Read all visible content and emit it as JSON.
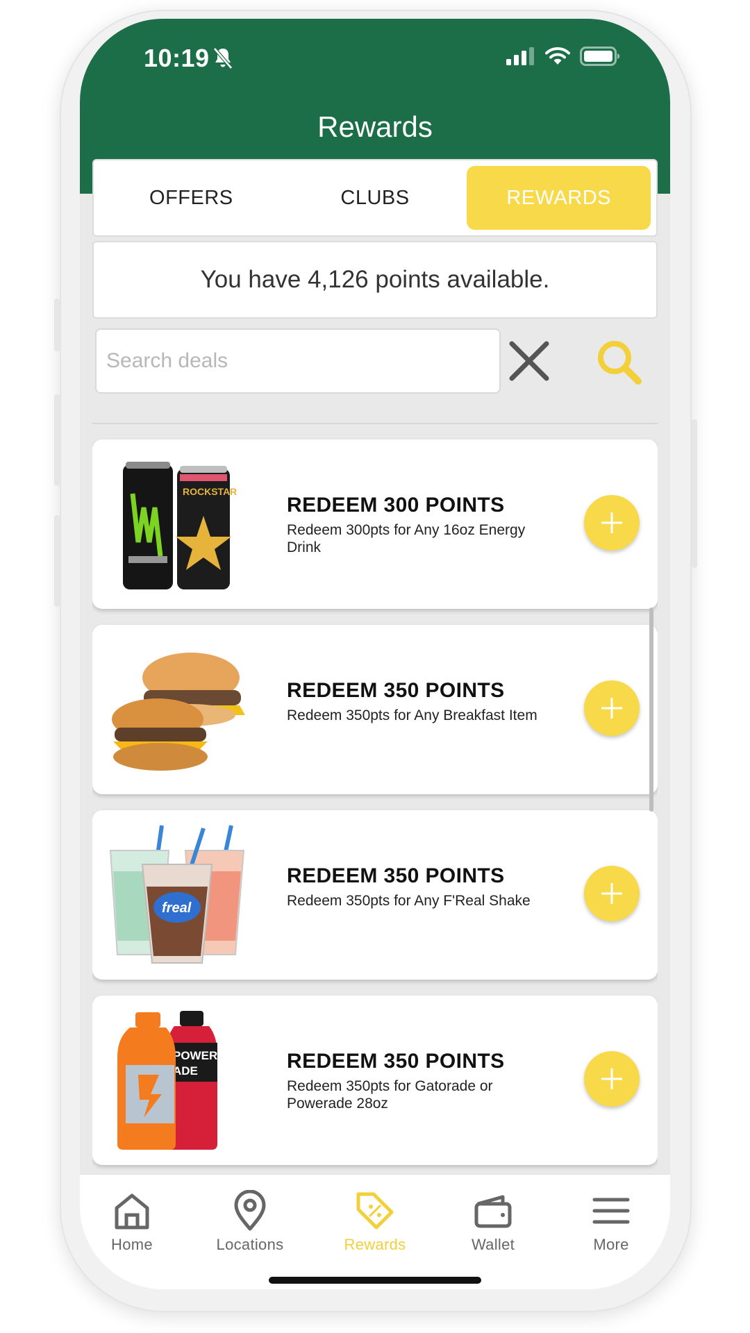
{
  "status_bar": {
    "time": "10:19"
  },
  "header": {
    "title": "Rewards"
  },
  "tabs": [
    {
      "label": "OFFERS",
      "active": false
    },
    {
      "label": "CLUBS",
      "active": false
    },
    {
      "label": "REWARDS",
      "active": true
    }
  ],
  "points": {
    "text": "You have 4,126 points available."
  },
  "search": {
    "placeholder": "Search deals",
    "value": ""
  },
  "rewards": [
    {
      "title": "REDEEM 300 POINTS",
      "description": "Redeem 300pts for Any 16oz Energy Drink",
      "image": "energy-drink-cans"
    },
    {
      "title": "REDEEM 350 POINTS",
      "description": "Redeem 350pts for Any Breakfast Item",
      "image": "breakfast-sandwiches"
    },
    {
      "title": "REDEEM 350 POINTS",
      "description": "Redeem 350pts for Any F'Real Shake",
      "image": "freal-shakes"
    },
    {
      "title": "REDEEM 350 POINTS",
      "description": "Redeem 350pts for Gatorade or Powerade 28oz",
      "image": "sports-drink-bottles"
    }
  ],
  "nav": [
    {
      "label": "Home",
      "icon": "home-icon",
      "active": false
    },
    {
      "label": "Locations",
      "icon": "location-pin-icon",
      "active": false
    },
    {
      "label": "Rewards",
      "icon": "tag-percent-icon",
      "active": true
    },
    {
      "label": "Wallet",
      "icon": "wallet-icon",
      "active": false
    },
    {
      "label": "More",
      "icon": "menu-icon",
      "active": false
    }
  ],
  "colors": {
    "brand_green": "#1b6e48",
    "accent_yellow": "#f7d94a",
    "background": "#e9e9e9"
  }
}
